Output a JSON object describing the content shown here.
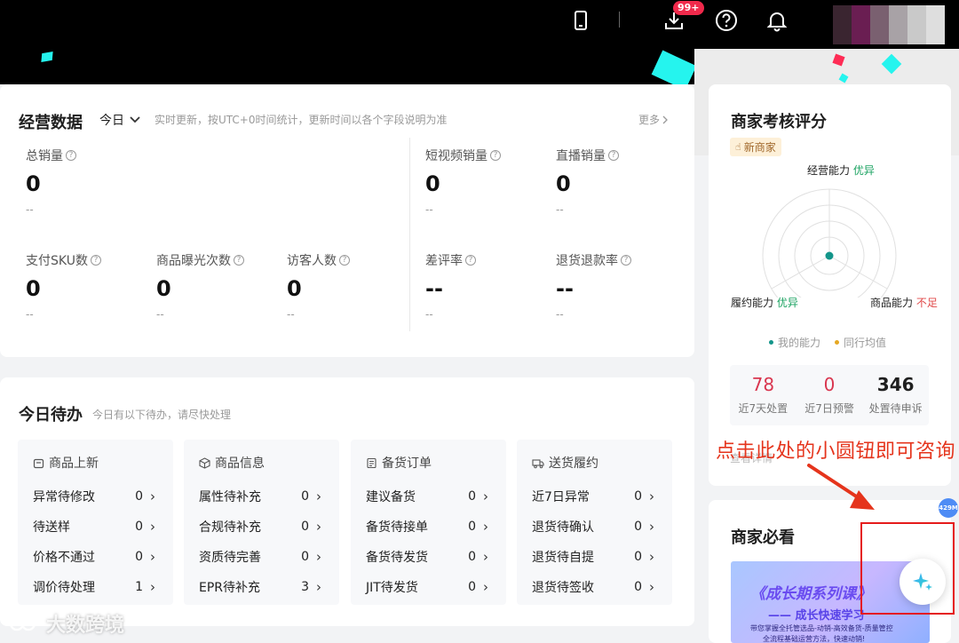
{
  "topbar": {
    "badge": "99+",
    "icons": [
      "phone-icon",
      "download-icon",
      "help-icon",
      "bell-icon"
    ]
  },
  "ops": {
    "title": "经营数据",
    "period": "今日",
    "note": "实时更新，按UTC+0时间统计，更新时间以各个字段说明为准",
    "more": "更多",
    "metrics": [
      {
        "label": "总销量",
        "value": "0",
        "sub": "--"
      },
      {
        "label": "短视频销量",
        "value": "0",
        "sub": "--"
      },
      {
        "label": "直播销量",
        "value": "0",
        "sub": "--"
      },
      {
        "label": "支付SKU数",
        "value": "0",
        "sub": "--"
      },
      {
        "label": "商品曝光次数",
        "value": "0",
        "sub": "--"
      },
      {
        "label": "访客人数",
        "value": "0",
        "sub": "--"
      },
      {
        "label": "差评率",
        "value": "--",
        "sub": "--"
      },
      {
        "label": "退货退款率",
        "value": "--",
        "sub": "--"
      }
    ]
  },
  "todo": {
    "title": "今日待办",
    "note": "今日有以下待办，请尽快处理",
    "columns": [
      {
        "title": "商品上新",
        "items": [
          {
            "label": "异常待修改",
            "count": "0"
          },
          {
            "label": "待送样",
            "count": "0"
          },
          {
            "label": "价格不通过",
            "count": "0"
          },
          {
            "label": "调价待处理",
            "count": "1"
          }
        ]
      },
      {
        "title": "商品信息",
        "items": [
          {
            "label": "属性待补充",
            "count": "0"
          },
          {
            "label": "合规待补充",
            "count": "0"
          },
          {
            "label": "资质待完善",
            "count": "0"
          },
          {
            "label": "EPR待补充",
            "count": "3"
          }
        ]
      },
      {
        "title": "备货订单",
        "items": [
          {
            "label": "建议备货",
            "count": "0"
          },
          {
            "label": "备货待接单",
            "count": "0"
          },
          {
            "label": "备货待发货",
            "count": "0"
          },
          {
            "label": "JIT待发货",
            "count": "0"
          }
        ]
      },
      {
        "title": "送货履约",
        "items": [
          {
            "label": "近7日异常",
            "count": "0"
          },
          {
            "label": "退货待确认",
            "count": "0"
          },
          {
            "label": "退货待自提",
            "count": "0"
          },
          {
            "label": "退货待签收",
            "count": "0"
          }
        ]
      }
    ]
  },
  "score": {
    "title": "商家考核评分",
    "tag": "新商家",
    "axes": [
      {
        "name": "经营能力",
        "grade": "优异",
        "color": "#1aa260"
      },
      {
        "name": "履约能力",
        "grade": "优异",
        "color": "#1aa260"
      },
      {
        "name": "商品能力",
        "grade": "不足",
        "color": "#e04a4a"
      }
    ],
    "legend": [
      "我的能力",
      "同行均值"
    ],
    "legend_colors": [
      "#13958a",
      "#e5a823"
    ],
    "stats": [
      {
        "value": "78",
        "label": "近7天处置",
        "color": "#d9364f"
      },
      {
        "value": "0",
        "label": "近7日预警",
        "color": "#d9364f"
      },
      {
        "value": "346",
        "label": "处置待申诉",
        "color": "#1f1f1f"
      }
    ],
    "overlap_text": "查看详情"
  },
  "must": {
    "title": "商家必看",
    "banner_title": "《成长期系列课》",
    "banner_sub": "—— 成长快速学习",
    "banner_line1": "带您掌握全托管选品-动销-高效备货-质量管控",
    "banner_line2": "全流程基础运营方法，快速动销!"
  },
  "annotation": "点击此处的小圆钮即可咨询",
  "float_tag": "429M",
  "watermark": "大数跨境"
}
